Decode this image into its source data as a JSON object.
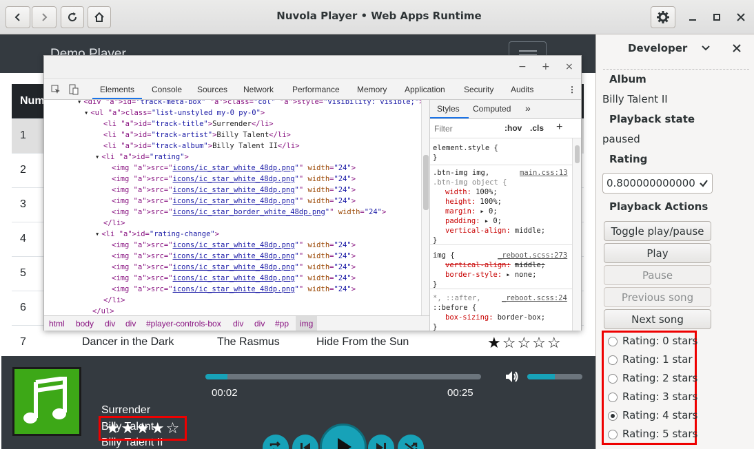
{
  "window": {
    "title": "Nuvola Player • Web Apps Runtime"
  },
  "web": {
    "brand": "Demo Player",
    "table_header": "Num",
    "rows": [
      {
        "num": "1"
      },
      {
        "num": "2"
      },
      {
        "num": "3"
      },
      {
        "num": "4"
      },
      {
        "num": "5"
      },
      {
        "num": "6"
      },
      {
        "num": "7",
        "title": "Dancer in the Dark",
        "artist": "The Rasmus",
        "album": "Hide From the Sun",
        "stars": "★☆☆☆☆"
      }
    ]
  },
  "player": {
    "title": "Surrender",
    "artist": "Billy Talent",
    "album": "Billy Talent II",
    "stars": [
      "★",
      "★",
      "★",
      "★",
      "☆"
    ],
    "elapsed": "00:02",
    "duration": "00:25",
    "progress": 0.08,
    "volume": 0.5
  },
  "devtools": {
    "tabs": [
      "Elements",
      "Console",
      "Sources",
      "Network",
      "Performance",
      "Memory",
      "Application",
      "Security",
      "Audits"
    ],
    "dom_lines": [
      {
        "tag": "<div",
        "attrs": " id=\"track-meta-box\" class=\"col\" style=\"visibility: visible;\">"
      },
      {
        "tag": "<ul",
        "attrs": " class=\"list-unstyled my-0 py-0\">"
      },
      {
        "tag": "<li",
        "attrs": " id=\"track-title\">",
        "text": "Surrender",
        "close": "</li>"
      },
      {
        "tag": "<li",
        "attrs": " id=\"track-artist\">",
        "text": "Billy Talent",
        "close": "</li>"
      },
      {
        "tag": "<li",
        "attrs": " id=\"track-album\">",
        "text": "Billy Talent II",
        "close": "</li>"
      },
      {
        "tag": "<li",
        "attrs": " id=\"rating\">"
      },
      {
        "tag": "<img",
        "attrs": " src=\"",
        "url": "icons/ic_star_white_48dp.png",
        "end": "\" width=\"24\">"
      },
      {
        "tag": "<img",
        "attrs": " src=\"",
        "url": "icons/ic_star_white_48dp.png",
        "end": "\" width=\"24\">"
      },
      {
        "tag": "<img",
        "attrs": " src=\"",
        "url": "icons/ic_star_white_48dp.png",
        "end": "\" width=\"24\">"
      },
      {
        "tag": "<img",
        "attrs": " src=\"",
        "url": "icons/ic_star_white_48dp.png",
        "end": "\" width=\"24\">"
      },
      {
        "tag": "<img",
        "attrs": " src=\"",
        "url": "icons/ic_star_border_white_48dp.png",
        "end": "\" width=\"24\">"
      },
      {
        "tag": "</li>"
      },
      {
        "tag": "<li",
        "attrs": " id=\"rating-change\">"
      },
      {
        "tag": "<img",
        "attrs": " src=\"",
        "url": "icons/ic_star_white_48dp.png",
        "end": "\" width=\"24\">"
      },
      {
        "tag": "<img",
        "attrs": " src=\"",
        "url": "icons/ic_star_white_48dp.png",
        "end": "\" width=\"24\">"
      },
      {
        "tag": "<img",
        "attrs": " src=\"",
        "url": "icons/ic_star_white_48dp.png",
        "end": "\" width=\"24\">"
      },
      {
        "tag": "<img",
        "attrs": " src=\"",
        "url": "icons/ic_star_white_48dp.png",
        "end": "\" width=\"24\">"
      },
      {
        "tag": "<img",
        "attrs": " src=\"",
        "url": "icons/ic_star_white_48dp.png",
        "end": "\" width=\"24\">"
      },
      {
        "tag": "</li>"
      },
      {
        "tag": "</ul>"
      }
    ],
    "breadcrumbs": [
      "html",
      "body",
      "div",
      "div",
      "#player-controls-box",
      "div",
      "div",
      "#pp",
      "img"
    ],
    "styles_tabs": [
      "Styles",
      "Computed"
    ],
    "filter_placeholder": "Filter",
    "hov": ":hov",
    "cls": ".cls",
    "rules": {
      "element": "element.style {",
      "r1_sel": ".btn-img img,",
      "r1_sel2": ".btn-img object {",
      "r1_src": "main.css:13",
      "r1_props": [
        "width: 100%;",
        "height: 100%;",
        "margin: ▸ 0;",
        "padding: ▸ 0;",
        "vertical-align: middle;"
      ],
      "r2_sel": "img {",
      "r2_src": "_reboot.scss:273",
      "r2_props": [
        "vertical-align: middle;",
        "border-style: ▸ none;"
      ],
      "r3_sel": "*, ::after,",
      "r3_sel2": "::before {",
      "r3_src": "_reboot.scss:24",
      "r3_props": [
        "box-sizing: border-box;"
      ]
    }
  },
  "developer": {
    "title": "Developer",
    "album_label": "Album",
    "album_value": "Billy Talent II",
    "state_label": "Playback state",
    "state_value": "paused",
    "rating_label": "Rating",
    "rating_value": "0.8000000000000",
    "actions_label": "Playback Actions",
    "buttons": [
      "Toggle play/pause",
      "Play",
      "Pause",
      "Previous song",
      "Next song"
    ],
    "radios": [
      "Rating: 0 stars",
      "Rating: 1 star",
      "Rating: 2 stars",
      "Rating: 3 stars",
      "Rating: 4 stars",
      "Rating: 5 stars"
    ],
    "selected_radio": 4
  }
}
